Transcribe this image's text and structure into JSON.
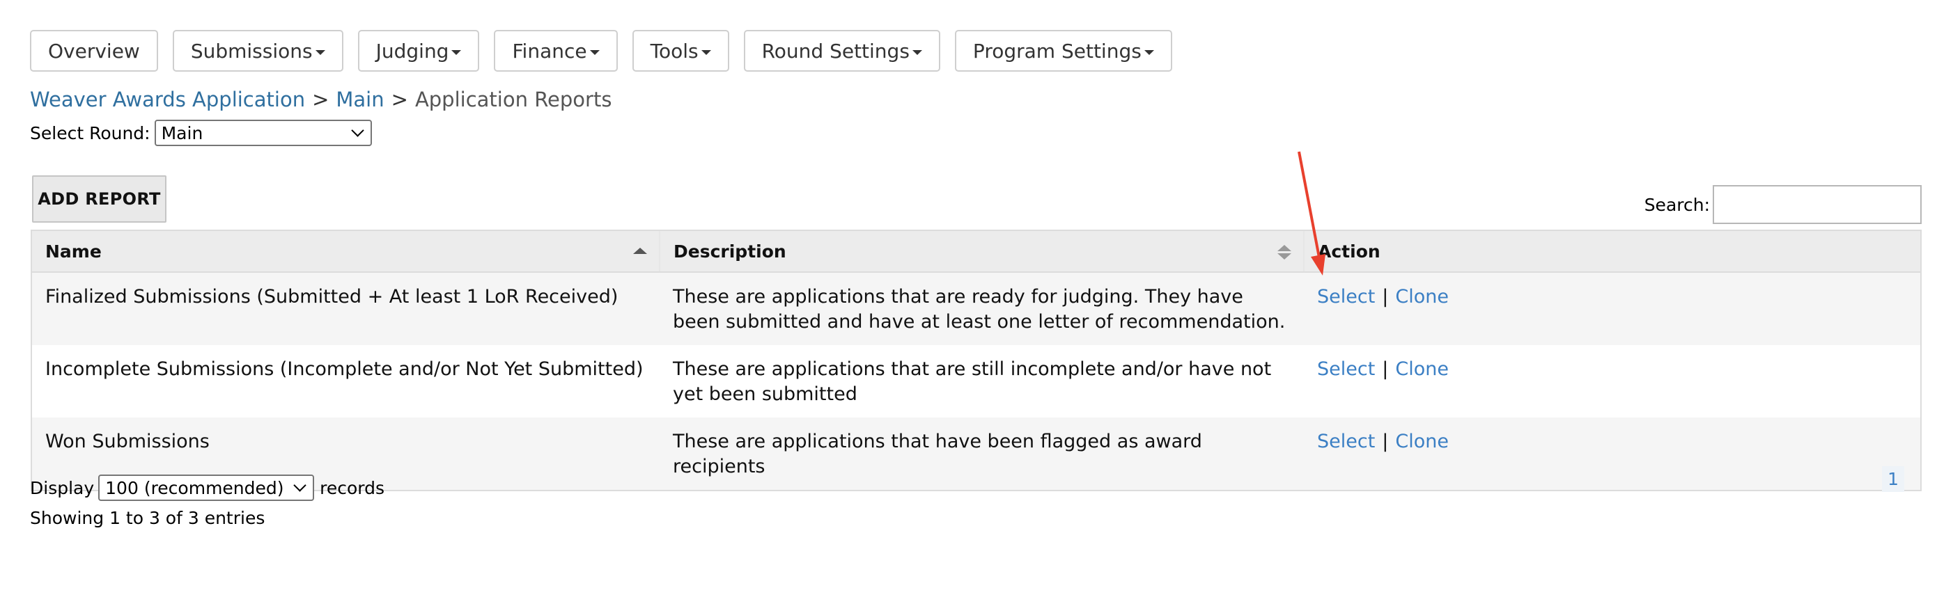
{
  "nav": [
    {
      "label": "Overview",
      "dropdown": false
    },
    {
      "label": "Submissions",
      "dropdown": true
    },
    {
      "label": "Judging",
      "dropdown": true
    },
    {
      "label": "Finance",
      "dropdown": true
    },
    {
      "label": "Tools",
      "dropdown": true
    },
    {
      "label": "Round Settings",
      "dropdown": true
    },
    {
      "label": "Program Settings",
      "dropdown": true
    }
  ],
  "breadcrumb": {
    "program": "Weaver Awards Application",
    "round": "Main",
    "current": "Application Reports",
    "separator": ">"
  },
  "round_select": {
    "label": "Select Round:",
    "value": "Main"
  },
  "add_report_label": "ADD REPORT",
  "search": {
    "label": "Search:",
    "value": ""
  },
  "table": {
    "headers": {
      "name": "Name",
      "description": "Description",
      "action": "Action"
    },
    "rows": [
      {
        "name": "Finalized Submissions (Submitted + At least 1 LoR Received)",
        "description": "These are applications that are ready for judging. They have been submitted and have at least one letter of recommendation.",
        "select": "Select",
        "pipe": "|",
        "clone": "Clone"
      },
      {
        "name": "Incomplete Submissions (Incomplete and/or Not Yet Submitted)",
        "description": "These are applications that are still incomplete and/or have not yet been submitted",
        "select": "Select",
        "pipe": "|",
        "clone": "Clone"
      },
      {
        "name": "Won Submissions",
        "description": "These are applications that have been flagged as award recipients",
        "select": "Select",
        "pipe": "|",
        "clone": "Clone"
      }
    ]
  },
  "display": {
    "prefix": "Display",
    "value": "100 (recommended)",
    "suffix": "records"
  },
  "showing_text": "Showing 1 to 3 of 3 entries",
  "pagination": {
    "current_page": "1"
  },
  "colors": {
    "link": "#3b7fc4",
    "breadcrumb_link": "#2f6f9f",
    "annotation_arrow": "#e8402d"
  }
}
